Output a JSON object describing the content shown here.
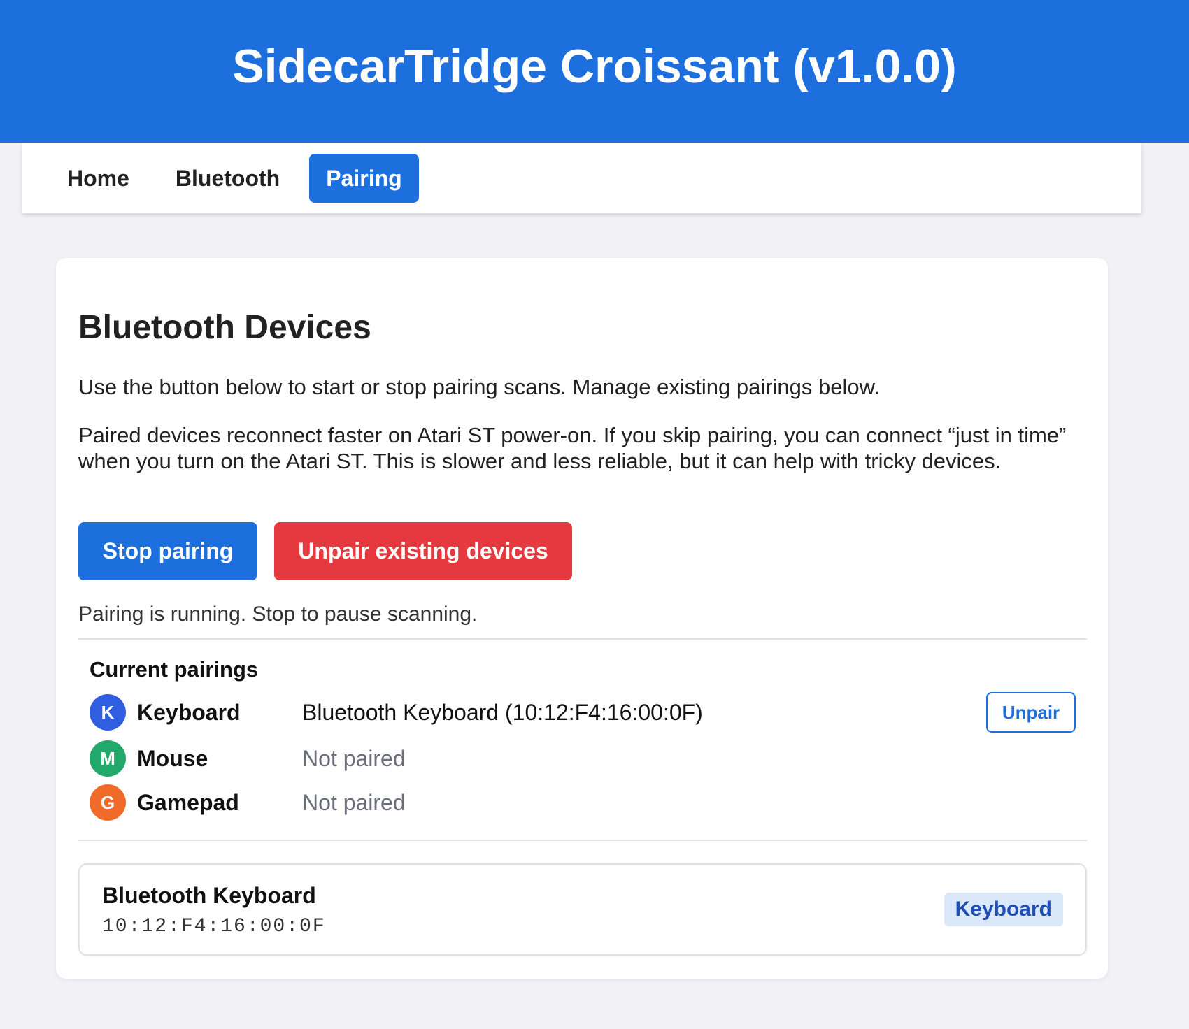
{
  "app": {
    "title": "SidecarTridge Croissant (v1.0.0)",
    "accent_color": "#1e6fde",
    "danger_color": "#e6393f"
  },
  "nav": {
    "items": [
      {
        "label": "Home",
        "active": false
      },
      {
        "label": "Bluetooth",
        "active": false
      },
      {
        "label": "Pairing",
        "active": true
      }
    ]
  },
  "main": {
    "title": "Bluetooth Devices",
    "intro": "Use the button below to start or stop pairing scans. Manage existing pairings below.",
    "info": "Paired devices reconnect faster on Atari ST power-on. If you skip pairing, you can connect “just in time” when you turn on the Atari ST. This is slower and less reliable, but it can help with tricky devices.",
    "stop_button": "Stop pairing",
    "unpair_all_button": "Unpair existing devices",
    "status": "Pairing is running. Stop to pause scanning."
  },
  "pairings": {
    "title": "Current pairings",
    "rows": [
      {
        "letter": "K",
        "type": "Keyboard",
        "value": "Bluetooth Keyboard (10:12:F4:16:00:0F)",
        "color": "#2f5fe0",
        "action": "Unpair",
        "icon": "keyboard-badge-icon"
      },
      {
        "letter": "M",
        "type": "Mouse",
        "value": "Not paired",
        "color": "#22a86b",
        "icon": "mouse-badge-icon"
      },
      {
        "letter": "G",
        "type": "Gamepad",
        "value": "Not paired",
        "color": "#f06a2a",
        "icon": "gamepad-badge-icon"
      }
    ]
  },
  "devices": [
    {
      "name": "Bluetooth Keyboard",
      "mac": "10:12:F4:16:00:0F",
      "badge": "Keyboard"
    }
  ]
}
